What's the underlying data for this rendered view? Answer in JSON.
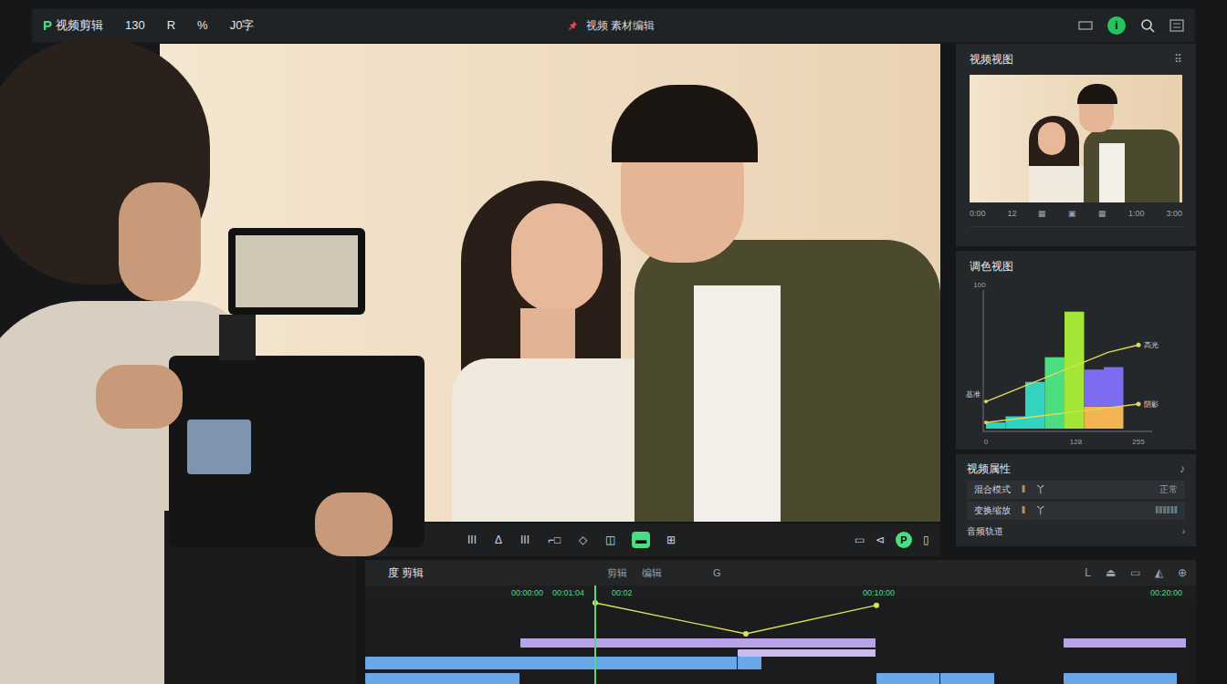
{
  "top_bar": {
    "logo": "P",
    "title": "视频剪辑",
    "items": [
      "130",
      "R",
      "%",
      "J0字"
    ],
    "center_text": "视频 素材编辑",
    "info_badge": "i"
  },
  "toolbar": {
    "items": [
      {
        "label": "III",
        "selected": false
      },
      {
        "label": "Δ",
        "selected": false
      },
      {
        "label": "III",
        "selected": false
      },
      {
        "label": "⌐□",
        "selected": false
      },
      {
        "label": "◇",
        "selected": false
      },
      {
        "label": "◫",
        "selected": false
      },
      {
        "label": "▬",
        "selected": true
      },
      {
        "label": "⊞",
        "selected": false
      }
    ],
    "right_items": [
      {
        "label": "▭",
        "selected": false
      },
      {
        "label": "⊲",
        "selected": false
      },
      {
        "label": "P",
        "selected": true
      },
      {
        "label": "▯",
        "selected": false
      }
    ]
  },
  "right_panel": {
    "preview_card": {
      "title": "视频视图",
      "menu": "⠿",
      "info": [
        "0:00",
        "12",
        "▦",
        "▣",
        "▦",
        "1:00",
        "3:00"
      ]
    },
    "chart_card": {
      "title": "调色视图",
      "y_ticks": [
        "100"
      ],
      "x_ticks": [
        "0",
        "128",
        "255"
      ],
      "bars": [
        {
          "segments": [
            {
              "value": 5,
              "color": "#2dd4bf"
            }
          ]
        },
        {
          "segments": [
            {
              "value": 10,
              "color": "#2dd4bf"
            }
          ]
        },
        {
          "segments": [
            {
              "value": 38,
              "color": "#34d3c0"
            }
          ]
        },
        {
          "segments": [
            {
              "value": 58,
              "color": "#4ade80"
            }
          ]
        },
        {
          "segments": [
            {
              "value": 95,
              "color": "#a3e635"
            }
          ]
        },
        {
          "segments": [
            {
              "value": 18,
              "color": "#f2b552"
            },
            {
              "value": 30,
              "color": "#7c6cf0"
            }
          ]
        },
        {
          "segments": [
            {
              "value": 18,
              "color": "#f2b552"
            },
            {
              "value": 32,
              "color": "#7c6cf0"
            }
          ]
        }
      ],
      "lines": [
        {
          "label": "高光",
          "values": [
            22,
            32,
            42,
            52,
            62,
            68
          ]
        },
        {
          "label": "阴影",
          "values": [
            5,
            8,
            11,
            14,
            17,
            20
          ]
        }
      ],
      "start_label": "基准"
    },
    "props_card": {
      "title": "视频属性",
      "icon": "♪",
      "rows": [
        [
          "混合模式",
          "‖",
          "丫",
          "正常"
        ],
        [
          "变换缩放",
          "‖",
          "丫",
          "‖‖‖‖‖‖"
        ]
      ],
      "footer": "音频轨道",
      "footer_icon": "›"
    }
  },
  "timeline": {
    "title": "度 剪辑",
    "center": [
      "剪辑",
      "编辑",
      "G"
    ],
    "right_tools": [
      "L",
      "⏏",
      "▭",
      "◭",
      "⊕"
    ],
    "ruler": [
      {
        "label": "00:00:00",
        "t": 16
      },
      {
        "label": "00:01:04",
        "t": 20.5
      },
      {
        "label": "00:02",
        "t": 27
      },
      {
        "label": "00:10:00",
        "t": 54.5
      },
      {
        "label": "00:20:00",
        "t": 86
      }
    ],
    "playhead": 25.2,
    "keyframes": [
      {
        "t": 25.2,
        "v": 1.0
      },
      {
        "t": 41.7,
        "v": 0.0
      },
      {
        "t": 56,
        "v": 0.92
      }
    ],
    "tracks": [
      {
        "color": "#b9a3e8",
        "clips": [
          [
            17,
            56
          ],
          [
            76.5,
            90
          ]
        ]
      },
      {
        "color": "#cbb9f2",
        "clips": [
          [
            40.8,
            56
          ]
        ]
      },
      {
        "color": "#6aa7e8",
        "clips": [
          [
            0,
            40.8
          ],
          [
            40.8,
            43.5
          ]
        ]
      },
      {
        "color": "#6aa7e8",
        "clips": [
          [
            0,
            17
          ],
          [
            56,
            63
          ],
          [
            63,
            69
          ],
          [
            76.5,
            89
          ]
        ]
      }
    ]
  }
}
